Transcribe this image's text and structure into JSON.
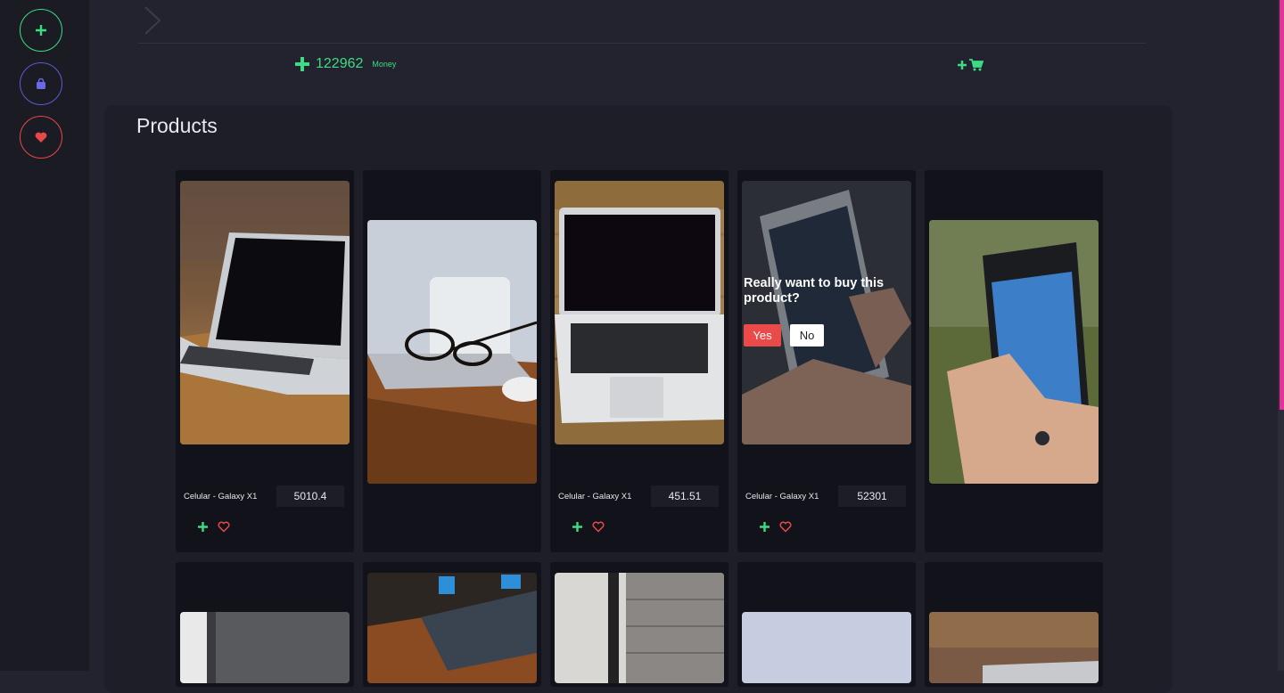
{
  "sidebar": {
    "buttons": [
      {
        "icon": "plus-icon",
        "color": "#3ddc84"
      },
      {
        "icon": "bag-icon",
        "color": "#5b5bd6"
      },
      {
        "icon": "heart-icon",
        "color": "#e84848"
      }
    ]
  },
  "header": {
    "money_value": "122962",
    "money_label": "Money"
  },
  "products": {
    "title": "Products",
    "cards": [
      {
        "name": "Celular - Galaxy X1",
        "price": "5010.4",
        "image": "laptop-on-desk"
      },
      {
        "name": "",
        "price": "",
        "image": "glasses-on-laptop"
      },
      {
        "name": "Celular - Galaxy X1",
        "price": "451.51",
        "image": "laptop-top-view"
      },
      {
        "name": "Celular - Galaxy X1",
        "price": "52301",
        "image": "phone-in-hand",
        "confirm": {
          "question": "Really want to buy this product?",
          "yes": "Yes",
          "no": "No"
        }
      },
      {
        "name": "",
        "price": "",
        "image": "iphone-in-hand"
      }
    ]
  },
  "colors": {
    "accent_green": "#3ddc84",
    "danger_red": "#e84848",
    "scroll_pink": "#e3329c"
  }
}
